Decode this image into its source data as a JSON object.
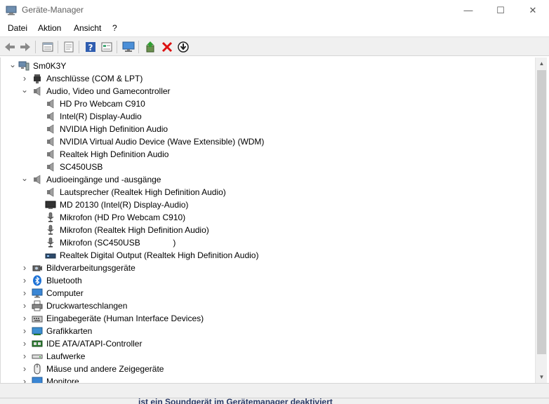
{
  "window": {
    "title": "Geräte-Manager",
    "controls": {
      "minimize": "—",
      "maximize": "☐",
      "close": "✕"
    }
  },
  "menu": [
    "Datei",
    "Aktion",
    "Ansicht",
    "?"
  ],
  "toolbar": [
    "back-icon",
    "forward-icon",
    "properties-view-icon",
    "show-hidden-icon",
    "help-icon",
    "details-icon",
    "monitor-scan-icon",
    "update-driver-icon",
    "uninstall-icon",
    "download-icon"
  ],
  "tree": [
    {
      "label": "Sm0K3Y",
      "icon": "computer-icon",
      "expander": "expanded"
    },
    {
      "label": "Anschlüsse (COM & LPT)",
      "icon": "port-icon",
      "expander": "collapsed"
    },
    {
      "label": "Audio, Video und Gamecontroller",
      "icon": "speaker-icon",
      "expander": "expanded"
    },
    {
      "label": "HD Pro Webcam C910",
      "icon": "speaker-icon",
      "expander": "none"
    },
    {
      "label": "Intel(R) Display-Audio",
      "icon": "speaker-icon",
      "expander": "none"
    },
    {
      "label": "NVIDIA High Definition Audio",
      "icon": "speaker-icon",
      "expander": "none"
    },
    {
      "label": "NVIDIA Virtual Audio Device (Wave Extensible) (WDM)",
      "icon": "speaker-icon",
      "expander": "none"
    },
    {
      "label": "Realtek High Definition Audio",
      "icon": "speaker-icon",
      "expander": "none"
    },
    {
      "label": "SC450USB",
      "icon": "speaker-icon",
      "expander": "none"
    },
    {
      "label": "Audioeingänge und -ausgänge",
      "icon": "speaker-icon",
      "expander": "expanded"
    },
    {
      "label": "Lautsprecher (Realtek High Definition Audio)",
      "icon": "speaker-icon",
      "expander": "none"
    },
    {
      "label": "MD 20130 (Intel(R) Display-Audio)",
      "icon": "display-icon",
      "expander": "none"
    },
    {
      "label": "Mikrofon (HD Pro Webcam C910)",
      "icon": "microphone-icon",
      "expander": "none"
    },
    {
      "label": "Mikrofon (Realtek High Definition Audio)",
      "icon": "microphone-icon",
      "expander": "none"
    },
    {
      "label": "Mikrofon (SC450USB              )",
      "icon": "microphone-icon",
      "expander": "none"
    },
    {
      "label": "Realtek Digital Output (Realtek High Definition Audio)",
      "icon": "digital-output-icon",
      "expander": "none"
    },
    {
      "label": "Bildverarbeitungsgeräte",
      "icon": "camera-icon",
      "expander": "collapsed"
    },
    {
      "label": "Bluetooth",
      "icon": "bluetooth-icon",
      "expander": "collapsed"
    },
    {
      "label": "Computer",
      "icon": "monitor-icon",
      "expander": "collapsed"
    },
    {
      "label": "Druckwarteschlangen",
      "icon": "printer-icon",
      "expander": "collapsed"
    },
    {
      "label": "Eingabegeräte (Human Interface Devices)",
      "icon": "hid-icon",
      "expander": "collapsed"
    },
    {
      "label": "Grafikkarten",
      "icon": "graphics-card-icon",
      "expander": "collapsed"
    },
    {
      "label": "IDE ATA/ATAPI-Controller",
      "icon": "ide-controller-icon",
      "expander": "collapsed"
    },
    {
      "label": "Laufwerke",
      "icon": "drive-icon",
      "expander": "collapsed"
    },
    {
      "label": "Mäuse und andere Zeigegeräte",
      "icon": "mouse-icon",
      "expander": "collapsed"
    },
    {
      "label": "Monitore",
      "icon": "monitor-icon",
      "expander": "collapsed"
    }
  ],
  "status": {
    "overlay_text": "ist ein Soundgerät im Gerätemanager deaktiviert"
  }
}
